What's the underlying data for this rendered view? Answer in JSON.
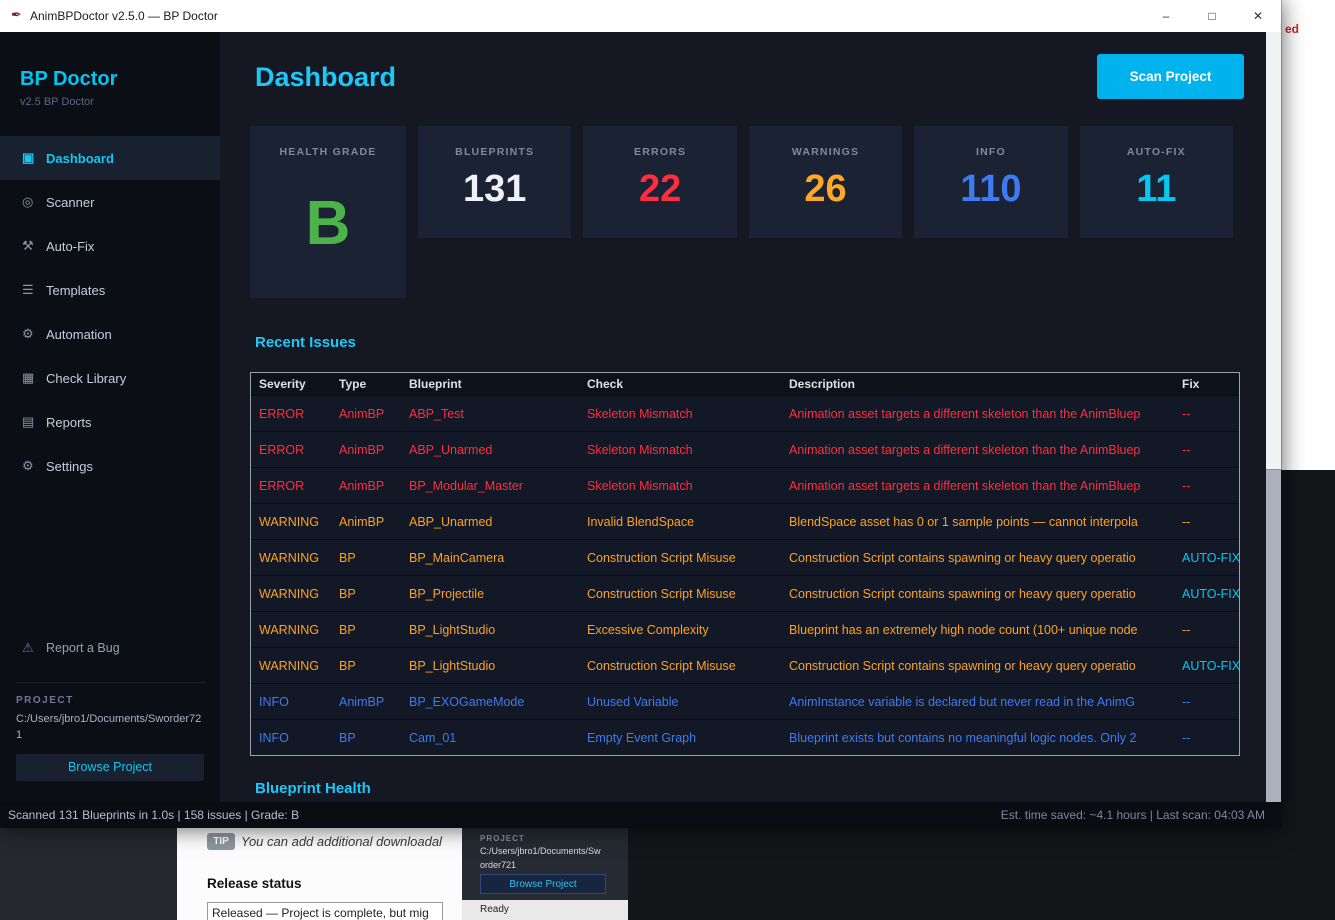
{
  "window": {
    "title": "AnimBPDoctor v2.5.0 — BP Doctor",
    "app_icon": "✒",
    "minimize": "–",
    "maximize": "□",
    "close": "✕"
  },
  "sidebar": {
    "brand": "BP Doctor",
    "version": "v2.5 BP Doctor",
    "items": [
      {
        "label": "Dashboard",
        "icon": "dashboard-icon",
        "glyph": "▣",
        "active": true
      },
      {
        "label": "Scanner",
        "icon": "scanner-icon",
        "glyph": "◎",
        "active": false
      },
      {
        "label": "Auto-Fix",
        "icon": "auto-fix-icon",
        "glyph": "⚒",
        "active": false
      },
      {
        "label": "Templates",
        "icon": "templates-icon",
        "glyph": "☰",
        "active": false
      },
      {
        "label": "Automation",
        "icon": "automation-icon",
        "glyph": "⚙",
        "active": false
      },
      {
        "label": "Check Library",
        "icon": "check-library-icon",
        "glyph": "▦",
        "active": false
      },
      {
        "label": "Reports",
        "icon": "reports-icon",
        "glyph": "▤",
        "active": false
      },
      {
        "label": "Settings",
        "icon": "settings-icon",
        "glyph": "⚙",
        "active": false
      }
    ],
    "report_bug": "Report a Bug",
    "report_bug_glyph": "⚠",
    "project_label": "PROJECT",
    "project_path": "C:/Users/jbro1/Documents/Sworder721",
    "browse_button": "Browse Project"
  },
  "header": {
    "title": "Dashboard",
    "scan_button": "Scan Project"
  },
  "stats": [
    {
      "label": "HEALTH GRADE",
      "value": "B",
      "color": "#4db24a"
    },
    {
      "label": "BLUEPRINTS",
      "value": "131",
      "color": "#eef1f7"
    },
    {
      "label": "ERRORS",
      "value": "22",
      "color": "#ff2e3f"
    },
    {
      "label": "WARNINGS",
      "value": "26",
      "color": "#ffa726"
    },
    {
      "label": "INFO",
      "value": "110",
      "color": "#3e7bf2"
    },
    {
      "label": "AUTO-FIX",
      "value": "11",
      "color": "#06c7f1"
    }
  ],
  "recent_issues": {
    "title": "Recent Issues",
    "columns": [
      "Severity",
      "Type",
      "Blueprint",
      "Check",
      "Description",
      "Fix"
    ],
    "severity_colors": {
      "ERROR": "#ff2e3f",
      "WARNING": "#ffa21f",
      "INFO": "#3e7bf2",
      "AUTOFIX": "#06c7f1"
    },
    "rows": [
      {
        "severity": "ERROR",
        "type": "AnimBP",
        "blueprint": "ABP_Test",
        "check": "Skeleton Mismatch",
        "description": "Animation asset targets a different skeleton than the AnimBluep",
        "fix": "--"
      },
      {
        "severity": "ERROR",
        "type": "AnimBP",
        "blueprint": "ABP_Unarmed",
        "check": "Skeleton Mismatch",
        "description": "Animation asset targets a different skeleton than the AnimBluep",
        "fix": "--"
      },
      {
        "severity": "ERROR",
        "type": "AnimBP",
        "blueprint": "BP_Modular_Master",
        "check": "Skeleton Mismatch",
        "description": "Animation asset targets a different skeleton than the AnimBluep",
        "fix": "--"
      },
      {
        "severity": "WARNING",
        "type": "AnimBP",
        "blueprint": "ABP_Unarmed",
        "check": "Invalid BlendSpace",
        "description": "BlendSpace asset has 0 or 1 sample points — cannot interpola",
        "fix": "--"
      },
      {
        "severity": "WARNING",
        "type": "BP",
        "blueprint": "BP_MainCamera",
        "check": "Construction Script Misuse",
        "description": "Construction Script contains spawning or heavy query operatio",
        "fix": "AUTO-FIX"
      },
      {
        "severity": "WARNING",
        "type": "BP",
        "blueprint": "BP_Projectile",
        "check": "Construction Script Misuse",
        "description": "Construction Script contains spawning or heavy query operatio",
        "fix": "AUTO-FIX"
      },
      {
        "severity": "WARNING",
        "type": "BP",
        "blueprint": "BP_LightStudio",
        "check": "Excessive Complexity",
        "description": "Blueprint has an extremely high node count (100+ unique node",
        "fix": "--"
      },
      {
        "severity": "WARNING",
        "type": "BP",
        "blueprint": "BP_LightStudio",
        "check": "Construction Script Misuse",
        "description": "Construction Script contains spawning or heavy query operatio",
        "fix": "AUTO-FIX"
      },
      {
        "severity": "INFO",
        "type": "AnimBP",
        "blueprint": "BP_EXOGameMode",
        "check": "Unused Variable",
        "description": "AnimInstance variable is declared but never read in the AnimG",
        "fix": "--"
      },
      {
        "severity": "INFO",
        "type": "BP",
        "blueprint": "Cam_01",
        "check": "Empty Event Graph",
        "description": "Blueprint exists but contains no meaningful logic nodes. Only 2",
        "fix": "--"
      }
    ]
  },
  "sections": {
    "blueprint_health": "Blueprint Health"
  },
  "status_bar": {
    "left": "Scanned 131 Blueprints in 1.0s | 158 issues | Grade: B",
    "right": "Est. time saved: ~4.1 hours | Last scan: 04:03 AM"
  },
  "background": {
    "top_right_fragment": "ed",
    "tip_badge": "TIP",
    "tip_text": "You can add additional downloadal",
    "release_status_label": "Release status",
    "release_status_value": "Released — Project is complete, but mig",
    "mini_project_label": "PROJECT",
    "mini_project_path": "C:/Users/jbro1/Documents/Sworder721",
    "mini_browse_button": "Browse Project",
    "mini_ready": "Ready"
  },
  "colors": {
    "accent": "#00c5f0",
    "grade": "#4db24a",
    "error": "#ff2e3f",
    "warning": "#ffa726",
    "info": "#3e7bf2",
    "autofix": "#06c7f1"
  }
}
